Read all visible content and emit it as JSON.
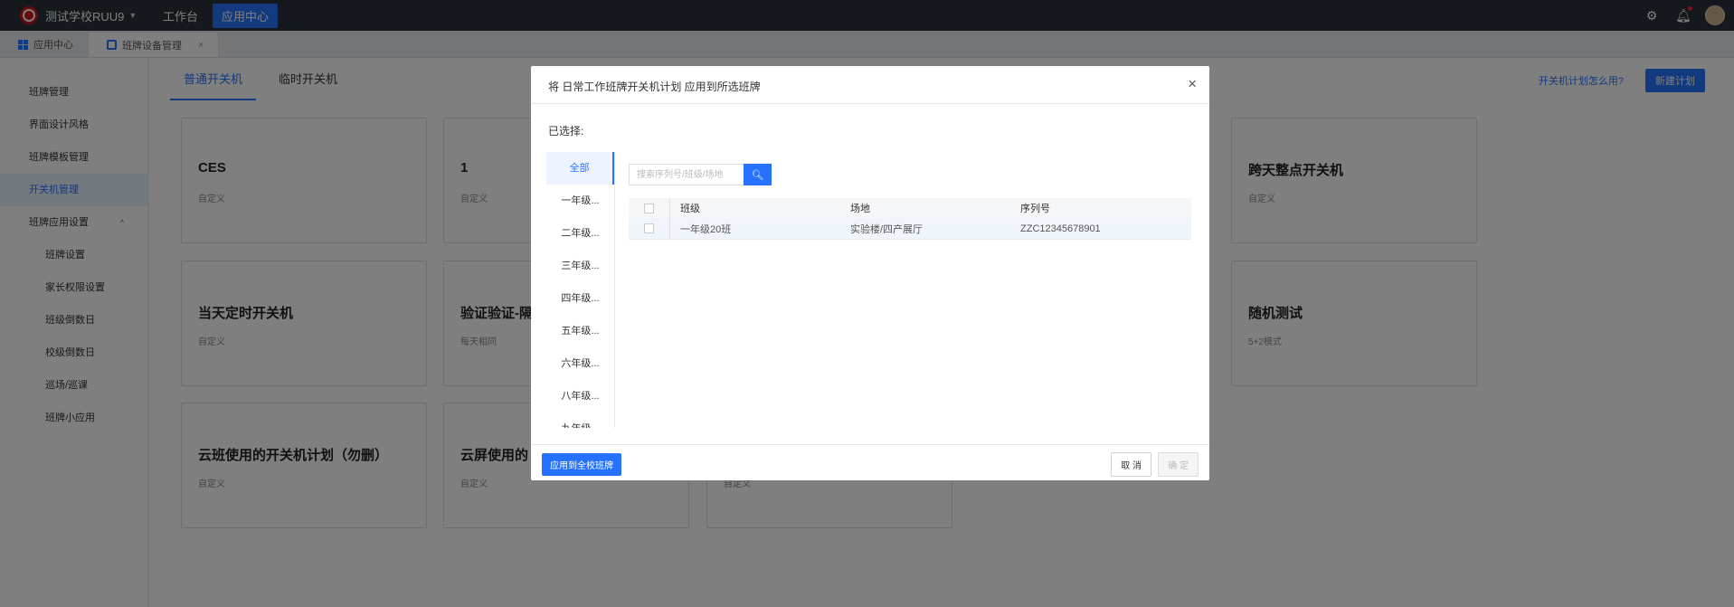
{
  "topbar": {
    "school_name": "测试学校RUU9",
    "nav": [
      {
        "label": "工作台",
        "active": false
      },
      {
        "label": "应用中心",
        "active": true
      }
    ]
  },
  "page_tabs": [
    {
      "label": "应用中心",
      "icon": "grid-icon",
      "active": false
    },
    {
      "label": "班牌设备管理",
      "icon": "device-icon",
      "active": true,
      "close": "×"
    }
  ],
  "sidebar": {
    "items": [
      {
        "label": "班牌管理"
      },
      {
        "label": "界面设计风格"
      },
      {
        "label": "班牌模板管理"
      },
      {
        "label": "开关机管理",
        "active": true
      },
      {
        "label": "班牌应用设置",
        "expand_icon": "^"
      },
      {
        "label": "班牌设置"
      },
      {
        "label": "家长权限设置"
      },
      {
        "label": "班级倒数日"
      },
      {
        "label": "校级倒数日"
      },
      {
        "label": "巡场/巡课"
      },
      {
        "label": "班牌小应用"
      }
    ]
  },
  "main": {
    "tabs": [
      {
        "label": "普通开关机",
        "active": true
      },
      {
        "label": "临时开关机",
        "active": false
      }
    ],
    "help_link": "开关机计划怎么用?",
    "new_button": "新建计划",
    "cards": [
      {
        "title": "CES",
        "subtitle": "自定义"
      },
      {
        "title": "1",
        "subtitle": "自定义"
      },
      {
        "title": "跨天整点开关机",
        "subtitle": "自定义"
      },
      {
        "title": "当天定时开关机",
        "subtitle": "自定义"
      },
      {
        "title": "验证验证-隔",
        "subtitle": "每天相同"
      },
      {
        "title": "随机测试",
        "subtitle": "5+2模式"
      },
      {
        "title": "云班使用的开关机计划（勿删）",
        "subtitle": "自定义"
      },
      {
        "title": "云屏使用的",
        "subtitle": "自定义"
      },
      {
        "title": "",
        "subtitle": "自定义"
      }
    ]
  },
  "modal": {
    "title": "将 日常工作班牌开关机计划 应用到所选班牌",
    "close": "×",
    "selected_label": "已选择:",
    "grades": [
      {
        "label": "全部",
        "active": true
      },
      {
        "label": "一年级..."
      },
      {
        "label": "二年级..."
      },
      {
        "label": "三年级..."
      },
      {
        "label": "四年级..."
      },
      {
        "label": "五年级..."
      },
      {
        "label": "六年级..."
      },
      {
        "label": "八年级..."
      },
      {
        "label": "九年级..."
      }
    ],
    "search_placeholder": "搜索序列号/班级/场地",
    "table": {
      "headers": [
        "班级",
        "场地",
        "序列号"
      ],
      "rows": [
        {
          "class": "一年级20班",
          "site": "实验楼/四产展厅",
          "serial": "ZZC12345678901"
        }
      ]
    },
    "apply_all_button": "应用到全校班牌",
    "cancel_button": "取 消",
    "ok_button": "确 定"
  }
}
